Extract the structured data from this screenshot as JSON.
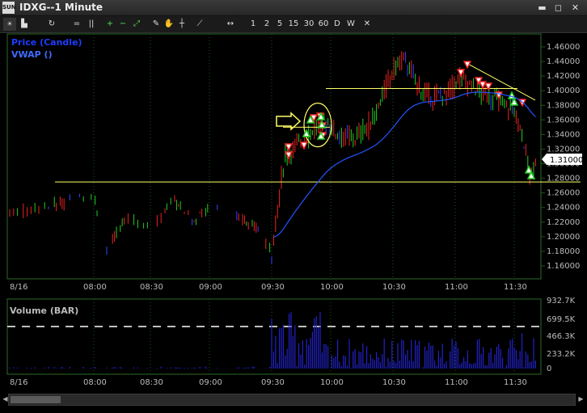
{
  "window": {
    "app_logo_text": "SUN",
    "title": "IDXG--1 Minute"
  },
  "window_controls": {
    "minimize": "▬",
    "restore": "◻",
    "close": "✕"
  },
  "toolbar": {
    "drawing_tools": [
      "+",
      "−",
      "⤢"
    ],
    "intervals": [
      "1",
      "2",
      "5",
      "15",
      "30",
      "60",
      "D",
      "W"
    ],
    "close_intervals": "✕"
  },
  "price_panel": {
    "legend": [
      {
        "label": "Price (Candle)",
        "color": "#1e3cff"
      },
      {
        "label": "VWAP ()",
        "color": "#3f6bff"
      }
    ],
    "y_ticks": [
      "1.46000",
      "1.44000",
      "1.42000",
      "1.40000",
      "1.38000",
      "1.36000",
      "1.34000",
      "1.32000",
      "1.30000",
      "1.28000",
      "1.26000",
      "1.24000",
      "1.22000",
      "1.20000",
      "1.18000",
      "1.16000"
    ],
    "current_price": "1.31000",
    "date_label": "8/16",
    "x_ticks": [
      "08:00",
      "08:30",
      "09:00",
      "09:30",
      "10:00",
      "10:30",
      "11:00",
      "11:30"
    ]
  },
  "volume_panel": {
    "title": "Volume (BAR)",
    "y_ticks": [
      "932.7K",
      "699.5K",
      "466.3K",
      "233.2K",
      "0"
    ],
    "date_label": "8/16",
    "x_ticks": [
      "08:00",
      "08:30",
      "09:00",
      "09:30",
      "10:00",
      "10:30",
      "11:00",
      "11:30"
    ]
  },
  "colors": {
    "up_candle": "#22cc22",
    "down_candle": "#ee2222",
    "neutral_candle": "#3344ff",
    "vwap": "#2255ff",
    "annotation": "#ffff66",
    "volume_bar": "#2222cc",
    "grid": "#1a5a1a",
    "axis_text": "#bbbbbb"
  }
}
